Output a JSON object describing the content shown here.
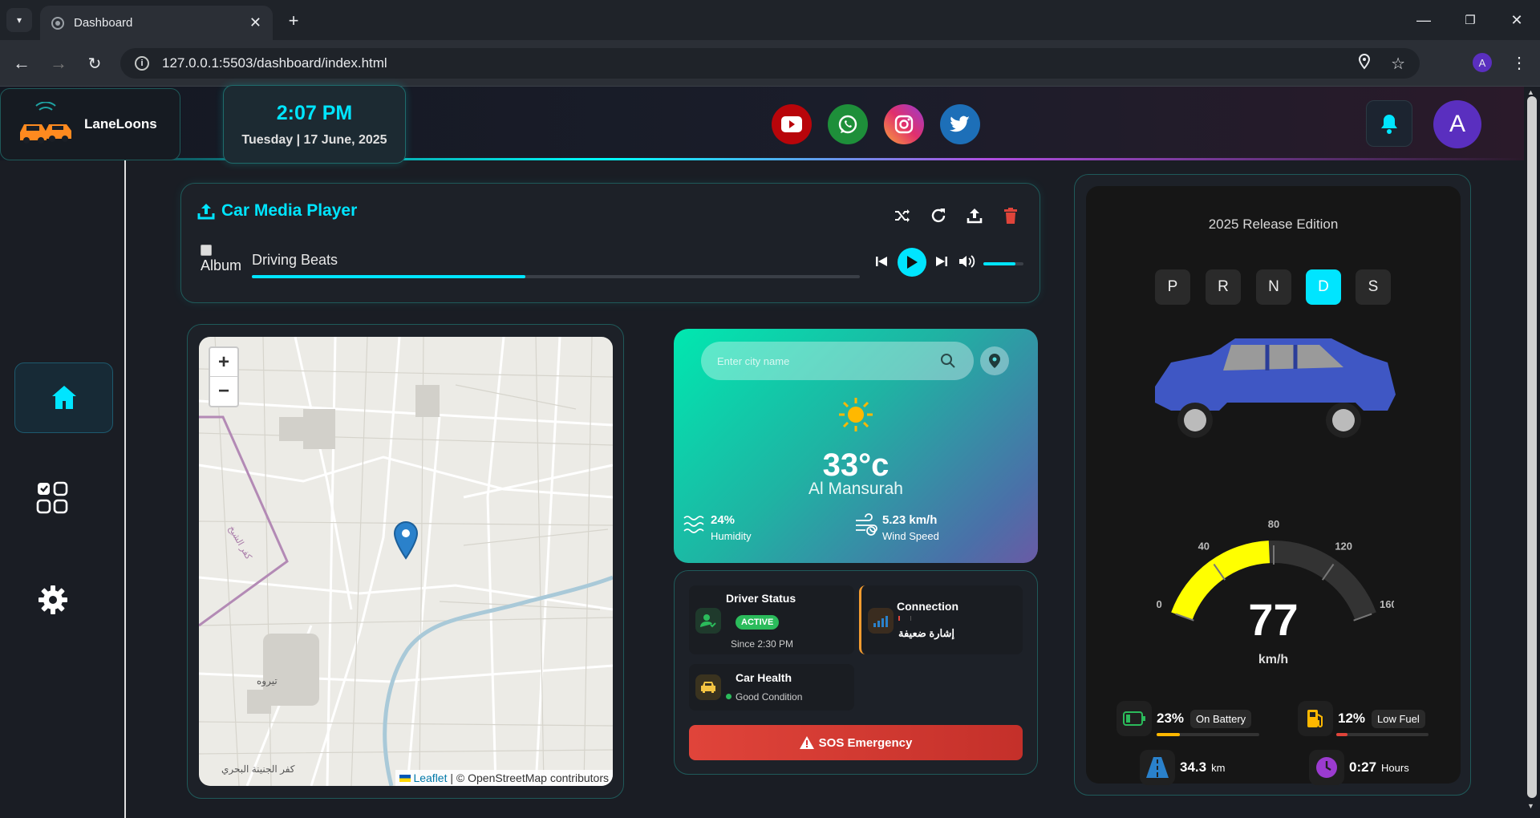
{
  "browser": {
    "tab_title": "Dashboard",
    "url": "127.0.0.1:5503/dashboard/index.html",
    "profile_initial": "A"
  },
  "header": {
    "brand": "LaneLoons",
    "time": "2:07 PM",
    "date": "Tuesday | 17 June, 2025",
    "avatar_initial": "A",
    "social": [
      "youtube-icon",
      "whatsapp-icon",
      "instagram-icon",
      "twitter-icon"
    ]
  },
  "sidebar": {
    "items": [
      "home-icon",
      "apps-icon",
      "settings-icon"
    ]
  },
  "media": {
    "title": "Car Media Player",
    "album_alt": "Album",
    "track": "Driving Beats",
    "progress": 0.45,
    "volume": 0.8
  },
  "map": {
    "zoom_in": "+",
    "zoom_out": "−",
    "place1": "تيروه",
    "place2": "كفر الجنينة البحري",
    "canal_label": "كفر الشيخ",
    "attribution_link": "Leaflet",
    "attribution_text": " | © OpenStreetMap contributors"
  },
  "weather": {
    "placeholder": "Enter city name",
    "temp": "33°c",
    "city": "Al Mansurah",
    "humidity_value": "24%",
    "humidity_label": "Humidity",
    "wind_value": "5.23 km/h",
    "wind_label": "Wind Speed"
  },
  "status": {
    "driver_title": "Driver Status",
    "driver_badge": "ACTIVE",
    "driver_since": "Since 2:30 PM",
    "connection_title": "Connection",
    "connection_value": "إشارة ضعيفة",
    "health_title": "Car Health",
    "health_value": "Good Condition",
    "sos": "SOS Emergency"
  },
  "car": {
    "edition": "2025 Release Edition",
    "gears": [
      "P",
      "R",
      "N",
      "D",
      "S"
    ],
    "active_gear": "D",
    "speed": "77",
    "speed_unit": "km/h",
    "speed_ticks": [
      "0",
      "40",
      "80",
      "120",
      "160"
    ],
    "battery_pct": "23%",
    "battery_tag": "On Battery",
    "fuel_pct": "12%",
    "fuel_tag": "Low Fuel",
    "distance": "34.3",
    "distance_unit": "km",
    "time_value": "0:27",
    "time_unit": "Hours",
    "colors": {
      "accent": "#00e5ff",
      "gauge": "#ffff00",
      "car_body": "#3f57c4"
    }
  }
}
